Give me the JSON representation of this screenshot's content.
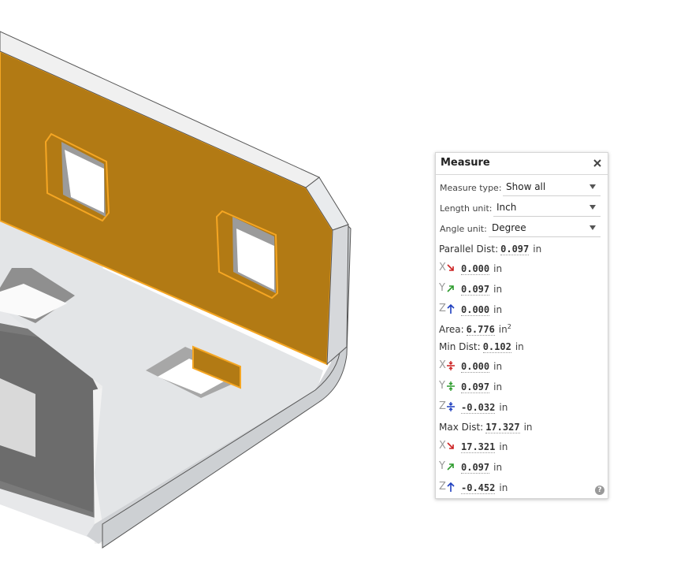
{
  "panel": {
    "title": "Measure",
    "measure_type_label": "Measure type:",
    "measure_type_value": "Show all",
    "length_unit_label": "Length unit:",
    "length_unit_value": "Inch",
    "angle_unit_label": "Angle unit:",
    "angle_unit_value": "Degree",
    "parallel": {
      "label": "Parallel Dist:",
      "value": "0.097",
      "unit": "in",
      "x": {
        "axis": "X",
        "value": "0.000",
        "unit": "in"
      },
      "y": {
        "axis": "Y",
        "value": "0.097",
        "unit": "in"
      },
      "z": {
        "axis": "Z",
        "value": "0.000",
        "unit": "in"
      }
    },
    "area": {
      "label": "Area:",
      "value": "6.776",
      "unit": "in",
      "unit_sup": "2"
    },
    "min": {
      "label": "Min Dist:",
      "value": "0.102",
      "unit": "in",
      "x": {
        "axis": "X",
        "value": "0.000",
        "unit": "in"
      },
      "y": {
        "axis": "Y",
        "value": "0.097",
        "unit": "in"
      },
      "z": {
        "axis": "Z",
        "value": "-0.032",
        "unit": "in"
      }
    },
    "max": {
      "label": "Max Dist:",
      "value": "17.327",
      "unit": "in",
      "x": {
        "axis": "X",
        "value": "17.321",
        "unit": "in"
      },
      "y": {
        "axis": "Y",
        "value": "0.097",
        "unit": "in"
      },
      "z": {
        "axis": "Z",
        "value": "-0.452",
        "unit": "in"
      }
    },
    "help_glyph": "?"
  },
  "colors": {
    "highlight_face": "#b27a14",
    "highlight_edge": "#f5a623",
    "part_light": "#e4e6e8",
    "part_mid": "#c9cbce",
    "part_dark": "#6e6e6e",
    "axis_x": "#cc2222",
    "axis_y": "#2b9b2b",
    "axis_z": "#1f3fbf"
  }
}
